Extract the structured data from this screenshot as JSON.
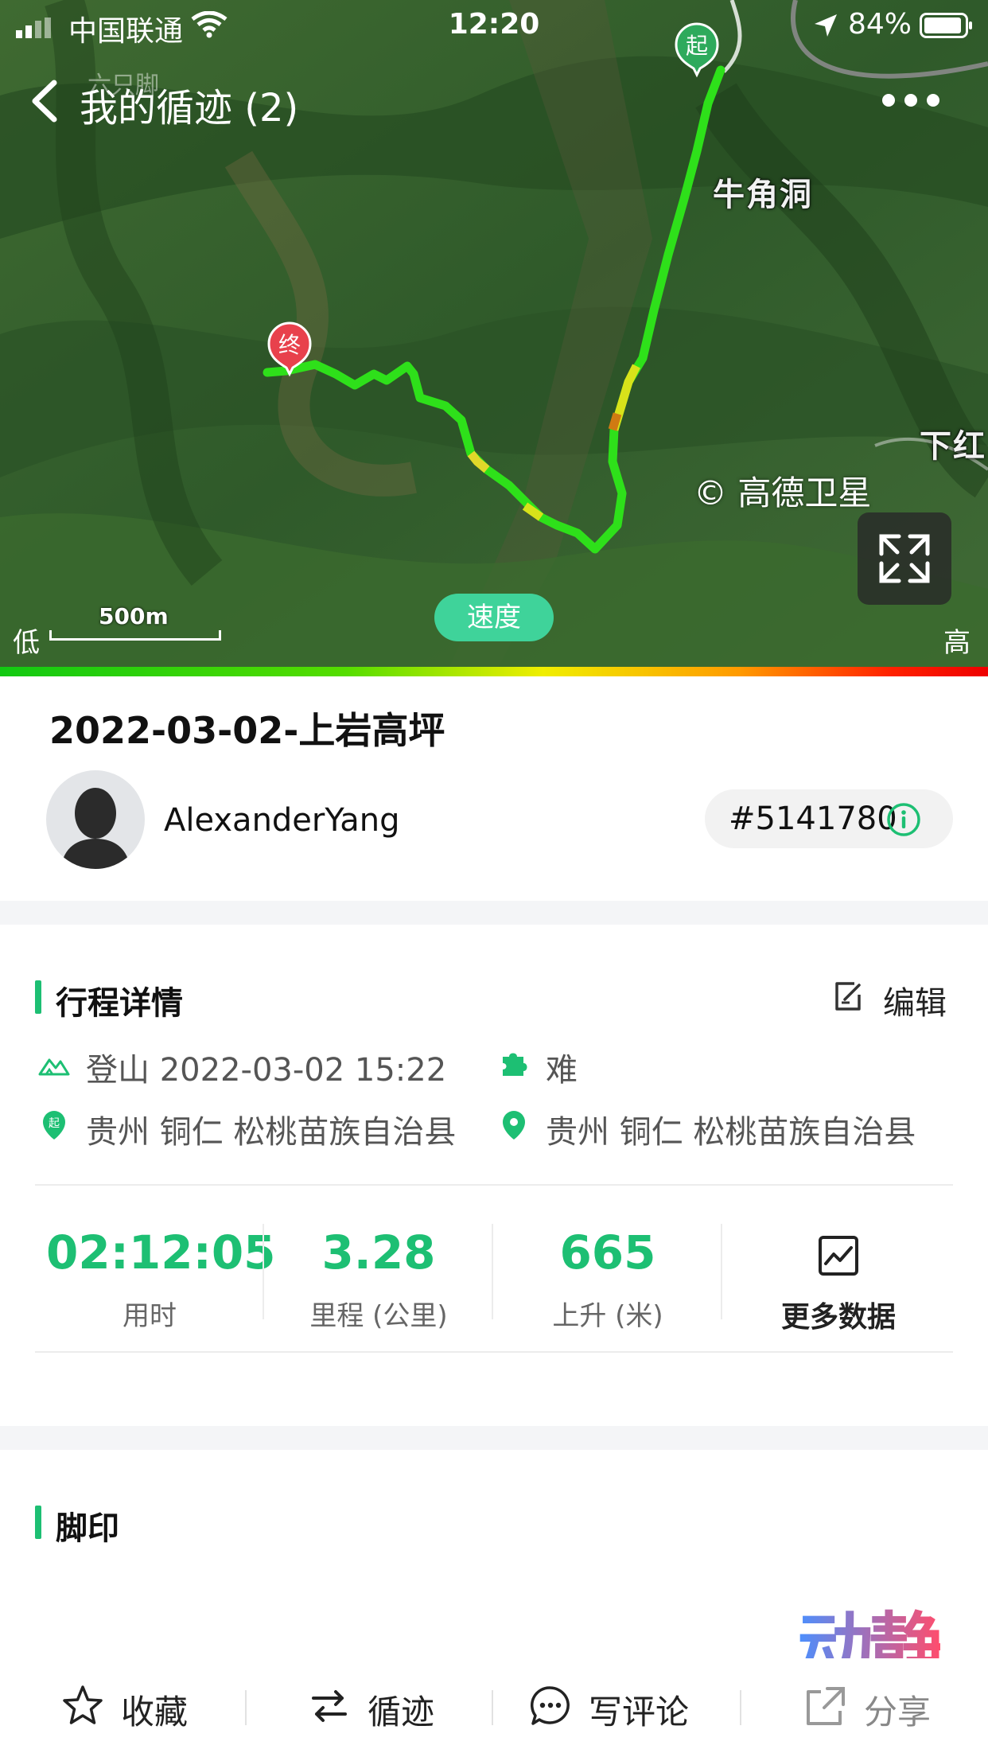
{
  "status_bar": {
    "carrier": "中国联通",
    "time": "12:20",
    "battery": "84%"
  },
  "nav": {
    "title": "我的循迹 (2)",
    "ghost_text": "六只脚"
  },
  "map": {
    "start_label": "起",
    "end_label": "终",
    "place_labels": [
      "牛角洞",
      "下红"
    ],
    "copyright": "© 高德卫星",
    "speed_chip": "速度",
    "scale_label": "500m",
    "legend_low": "低",
    "legend_high": "高"
  },
  "trip": {
    "title": "2022-03-02-上岩高坪",
    "username": "AlexanderYang",
    "trip_id": "#5141780"
  },
  "details": {
    "section_title": "行程详情",
    "edit_label": "编辑",
    "activity": "登山 2022-03-02 15:22",
    "difficulty": "难",
    "start_location": "贵州 铜仁 松桃苗族自治县",
    "end_location": "贵州 铜仁 松桃苗族自治县",
    "start_badge": "起",
    "stats": [
      {
        "value": "02:12:05",
        "label": "用时"
      },
      {
        "value": "3.28",
        "label": "里程 (公里)"
      },
      {
        "value": "665",
        "label": "上升 (米)"
      }
    ],
    "more_data_label": "更多数据"
  },
  "footprint": {
    "section_title": "脚印"
  },
  "watermark": "动静",
  "bottom_bar": [
    {
      "label": "收藏",
      "icon": "star-icon"
    },
    {
      "label": "循迹",
      "icon": "track-icon"
    },
    {
      "label": "写评论",
      "icon": "comment-icon"
    },
    {
      "label": "分享",
      "icon": "share-icon"
    }
  ],
  "colors": {
    "accent": "#1dbf73",
    "speed_chip": "#3fd39a",
    "end_pin": "#e8414c",
    "start_pin": "#2eaa5c"
  }
}
